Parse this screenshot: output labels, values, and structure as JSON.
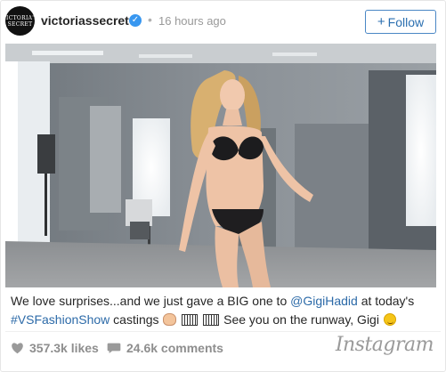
{
  "header": {
    "avatar_text": "VICTORIA'S SECRET",
    "username": "victoriassecret",
    "verified_icon": "verified-badge-icon",
    "separator": "•",
    "timestamp": "16 hours ago",
    "follow_label": "Follow",
    "follow_plus": "+"
  },
  "post": {
    "image_alt": "Model walking in black lingerie during casting in a photo studio",
    "caption_part1": "We love surprises...and we just gave a BIG one to ",
    "mention": "@GigiHadid",
    "caption_part2": " at today's ",
    "hashtag": "#VSFashionShow",
    "caption_part3": " castings ",
    "caption_part4": " See you on the runway, Gigi "
  },
  "footer": {
    "likes": "357.3k likes",
    "comments": "24.6k comments",
    "brand": "Instagram"
  },
  "colors": {
    "link": "#2c6aa8",
    "follow_border": "#4a87c5",
    "verified": "#3897f0",
    "meta_gray": "#8e8e8e"
  }
}
